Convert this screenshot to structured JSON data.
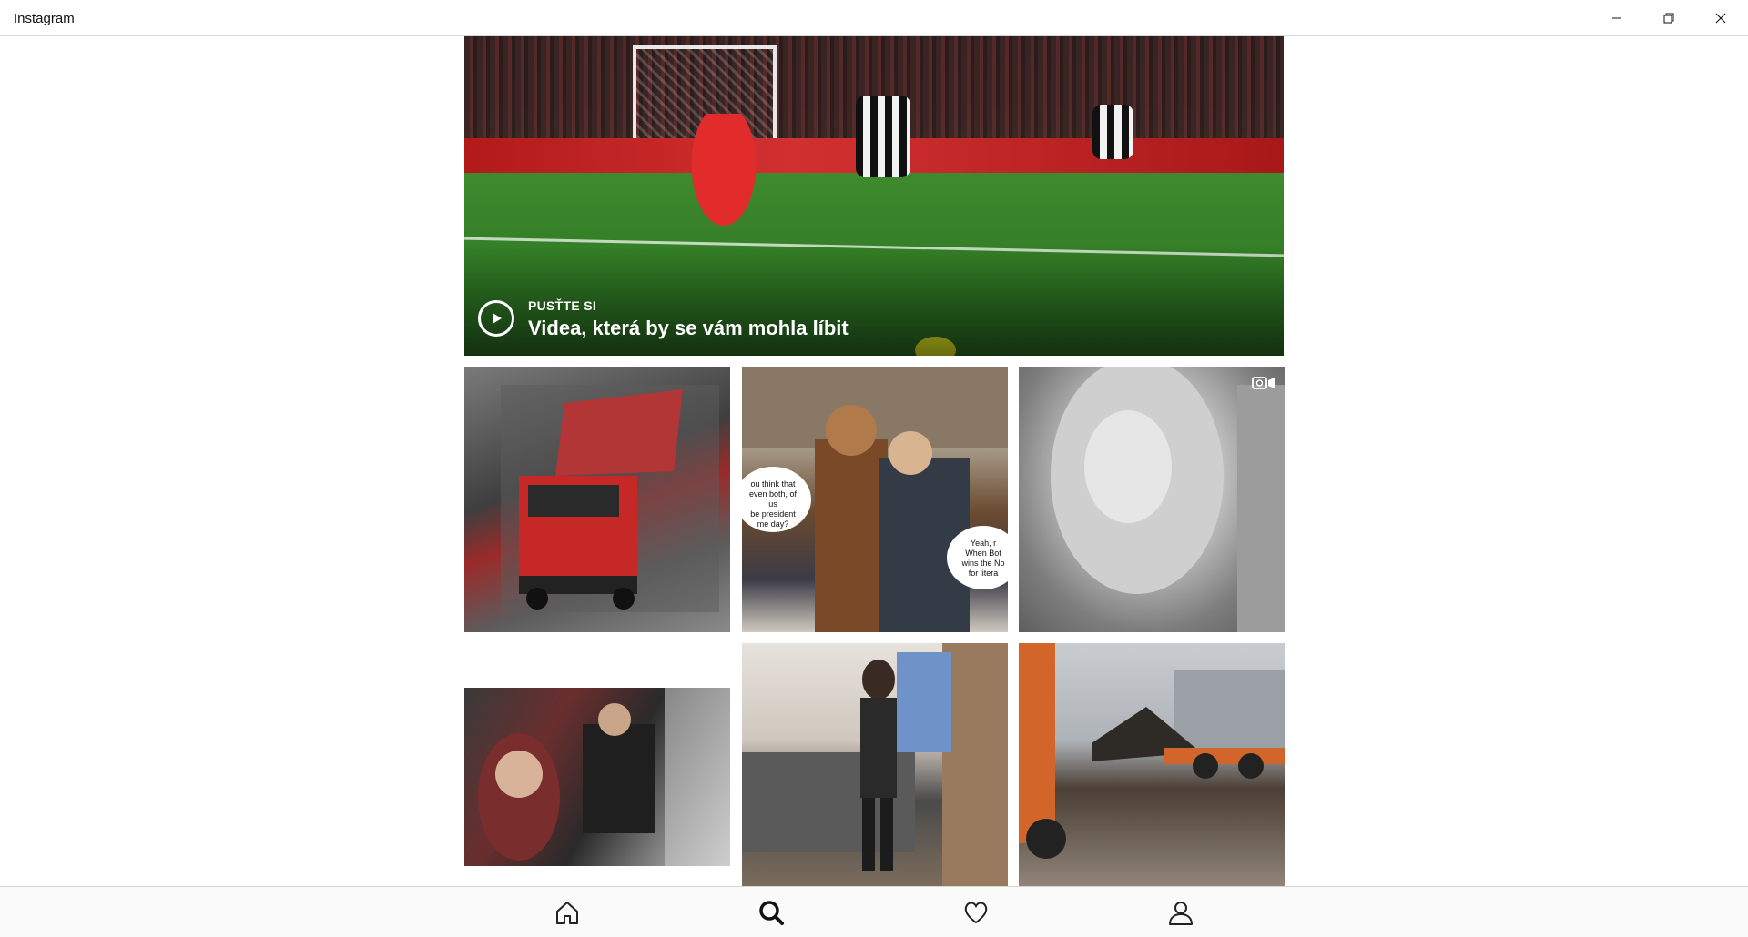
{
  "window": {
    "title": "Instagram",
    "controls": [
      "minimize-icon",
      "restore-icon",
      "close-icon"
    ]
  },
  "hero": {
    "kicker": "PUSŤTE SI",
    "headline": "Videa, která by se vám mohla líbit",
    "icon": "play-circle-icon"
  },
  "bubbles": {
    "left": "ou think that\neven both, of us\nbe president\nme day?",
    "right": "Yeah, r\nWhen Bot\nwins the No\nfor litera"
  },
  "grid": {
    "video_badge_icon": "video-camera-icon"
  },
  "nav": {
    "items": [
      {
        "icon": "home-icon",
        "active": false
      },
      {
        "icon": "search-icon",
        "active": true
      },
      {
        "icon": "heart-icon",
        "active": false
      },
      {
        "icon": "profile-icon",
        "active": false
      }
    ]
  }
}
